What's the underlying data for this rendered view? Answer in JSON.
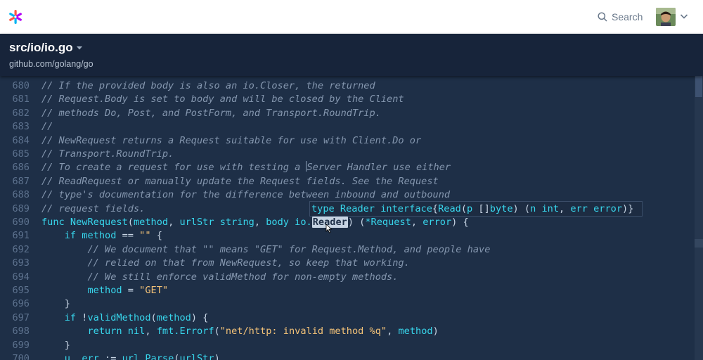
{
  "header": {
    "search_label": "Search"
  },
  "file": {
    "path": "src/io/io.go",
    "repo": "github.com/golang/go"
  },
  "code_lines": [
    {
      "n": "680",
      "tokens": [
        {
          "t": "c",
          "v": "// If the provided body is also an io.Closer, the returned"
        }
      ]
    },
    {
      "n": "681",
      "tokens": [
        {
          "t": "c",
          "v": "// Request.Body is set to body and will be closed by the Client"
        }
      ]
    },
    {
      "n": "682",
      "tokens": [
        {
          "t": "c",
          "v": "// methods Do, Post, and PostForm, and Transport.RoundTrip."
        }
      ]
    },
    {
      "n": "683",
      "tokens": [
        {
          "t": "c",
          "v": "//"
        }
      ]
    },
    {
      "n": "684",
      "tokens": [
        {
          "t": "c",
          "v": "// NewRequest returns a Request suitable for use with Client.Do or"
        }
      ]
    },
    {
      "n": "685",
      "tokens": [
        {
          "t": "c",
          "v": "// Transport.RoundTrip."
        }
      ]
    },
    {
      "n": "686",
      "tokens": [
        {
          "t": "c",
          "v": "// To create a request for use with testing a "
        },
        {
          "t": "cursor",
          "v": ""
        },
        {
          "t": "c",
          "v": "Server Handler use either"
        }
      ]
    },
    {
      "n": "687",
      "tokens": [
        {
          "t": "c",
          "v": "// ReadRequest or manually update the Request fields. See the Request"
        }
      ]
    },
    {
      "n": "688",
      "tokens": [
        {
          "t": "c",
          "v": "// type's documentation for the difference between inbound and outbound"
        }
      ]
    },
    {
      "n": "689",
      "tokens": [
        {
          "t": "c",
          "v": "// request fields."
        }
      ]
    },
    {
      "n": "690",
      "tokens": [
        {
          "t": "k",
          "v": "func "
        },
        {
          "t": "f",
          "v": "NewRequest"
        },
        {
          "t": "p",
          "v": "("
        },
        {
          "t": "k",
          "v": "method"
        },
        {
          "t": "p",
          "v": ", "
        },
        {
          "t": "k",
          "v": "urlStr string"
        },
        {
          "t": "p",
          "v": ", "
        },
        {
          "t": "k",
          "v": "body io."
        },
        {
          "t": "hl",
          "v": "Reader"
        },
        {
          "t": "p",
          "v": ") ("
        },
        {
          "t": "k",
          "v": "*Request"
        },
        {
          "t": "p",
          "v": ", "
        },
        {
          "t": "k",
          "v": "error"
        },
        {
          "t": "p",
          "v": ") {"
        }
      ]
    },
    {
      "n": "691",
      "tokens": [
        {
          "t": "p",
          "v": "    "
        },
        {
          "t": "k",
          "v": "if method"
        },
        {
          "t": "p",
          "v": " == "
        },
        {
          "t": "s",
          "v": "\"\""
        },
        {
          "t": "p",
          "v": " {"
        }
      ]
    },
    {
      "n": "692",
      "tokens": [
        {
          "t": "p",
          "v": "        "
        },
        {
          "t": "c",
          "v": "// We document that \"\" means \"GET\" for Request.Method, and people have"
        }
      ]
    },
    {
      "n": "693",
      "tokens": [
        {
          "t": "p",
          "v": "        "
        },
        {
          "t": "c",
          "v": "// relied on that from NewRequest, so keep that working."
        }
      ]
    },
    {
      "n": "694",
      "tokens": [
        {
          "t": "p",
          "v": "        "
        },
        {
          "t": "c",
          "v": "// We still enforce validMethod for non-empty methods."
        }
      ]
    },
    {
      "n": "695",
      "tokens": [
        {
          "t": "p",
          "v": "        "
        },
        {
          "t": "k",
          "v": "method"
        },
        {
          "t": "p",
          "v": " = "
        },
        {
          "t": "s",
          "v": "\"GET\""
        }
      ]
    },
    {
      "n": "696",
      "tokens": [
        {
          "t": "p",
          "v": "    }"
        }
      ]
    },
    {
      "n": "697",
      "tokens": [
        {
          "t": "p",
          "v": "    "
        },
        {
          "t": "k",
          "v": "if"
        },
        {
          "t": "p",
          "v": " !"
        },
        {
          "t": "f",
          "v": "validMethod"
        },
        {
          "t": "p",
          "v": "("
        },
        {
          "t": "k",
          "v": "method"
        },
        {
          "t": "p",
          "v": ") {"
        }
      ]
    },
    {
      "n": "698",
      "tokens": [
        {
          "t": "p",
          "v": "        "
        },
        {
          "t": "k",
          "v": "return nil"
        },
        {
          "t": "p",
          "v": ", "
        },
        {
          "t": "k",
          "v": "fmt."
        },
        {
          "t": "f",
          "v": "Errorf"
        },
        {
          "t": "p",
          "v": "("
        },
        {
          "t": "s",
          "v": "\"net/http: invalid method %q\""
        },
        {
          "t": "p",
          "v": ", "
        },
        {
          "t": "k",
          "v": "method"
        },
        {
          "t": "p",
          "v": ")"
        }
      ]
    },
    {
      "n": "699",
      "tokens": [
        {
          "t": "p",
          "v": "    }"
        }
      ]
    },
    {
      "n": "700",
      "tokens": [
        {
          "t": "p",
          "v": "    "
        },
        {
          "t": "k",
          "v": "u"
        },
        {
          "t": "p",
          "v": ", "
        },
        {
          "t": "k",
          "v": "err"
        },
        {
          "t": "p",
          "v": " := "
        },
        {
          "t": "k",
          "v": "url."
        },
        {
          "t": "f",
          "v": "Parse"
        },
        {
          "t": "p",
          "v": "("
        },
        {
          "t": "k",
          "v": "urlStr"
        },
        {
          "t": "p",
          "v": ")"
        }
      ]
    }
  ],
  "tooltip": {
    "tokens": [
      {
        "t": "k",
        "v": "type "
      },
      {
        "t": "f",
        "v": "Reader "
      },
      {
        "t": "k",
        "v": "interface"
      },
      {
        "t": "p",
        "v": "{"
      },
      {
        "t": "f",
        "v": "Read"
      },
      {
        "t": "p",
        "v": "("
      },
      {
        "t": "k",
        "v": "p "
      },
      {
        "t": "p",
        "v": "[]"
      },
      {
        "t": "k",
        "v": "byte"
      },
      {
        "t": "p",
        "v": ") ("
      },
      {
        "t": "k",
        "v": "n int"
      },
      {
        "t": "p",
        "v": ", "
      },
      {
        "t": "k",
        "v": "err error"
      },
      {
        "t": "p",
        "v": ")}"
      }
    ]
  },
  "colors": {
    "background": "#1e2f47",
    "keyword": "#38d6ec",
    "string": "#f3c278",
    "comment": "#8496ae",
    "line_number": "#5d728e"
  },
  "icons": [
    "logo-icon",
    "search-icon",
    "chevron-down-icon",
    "avatar",
    "mouse-cursor-icon"
  ]
}
